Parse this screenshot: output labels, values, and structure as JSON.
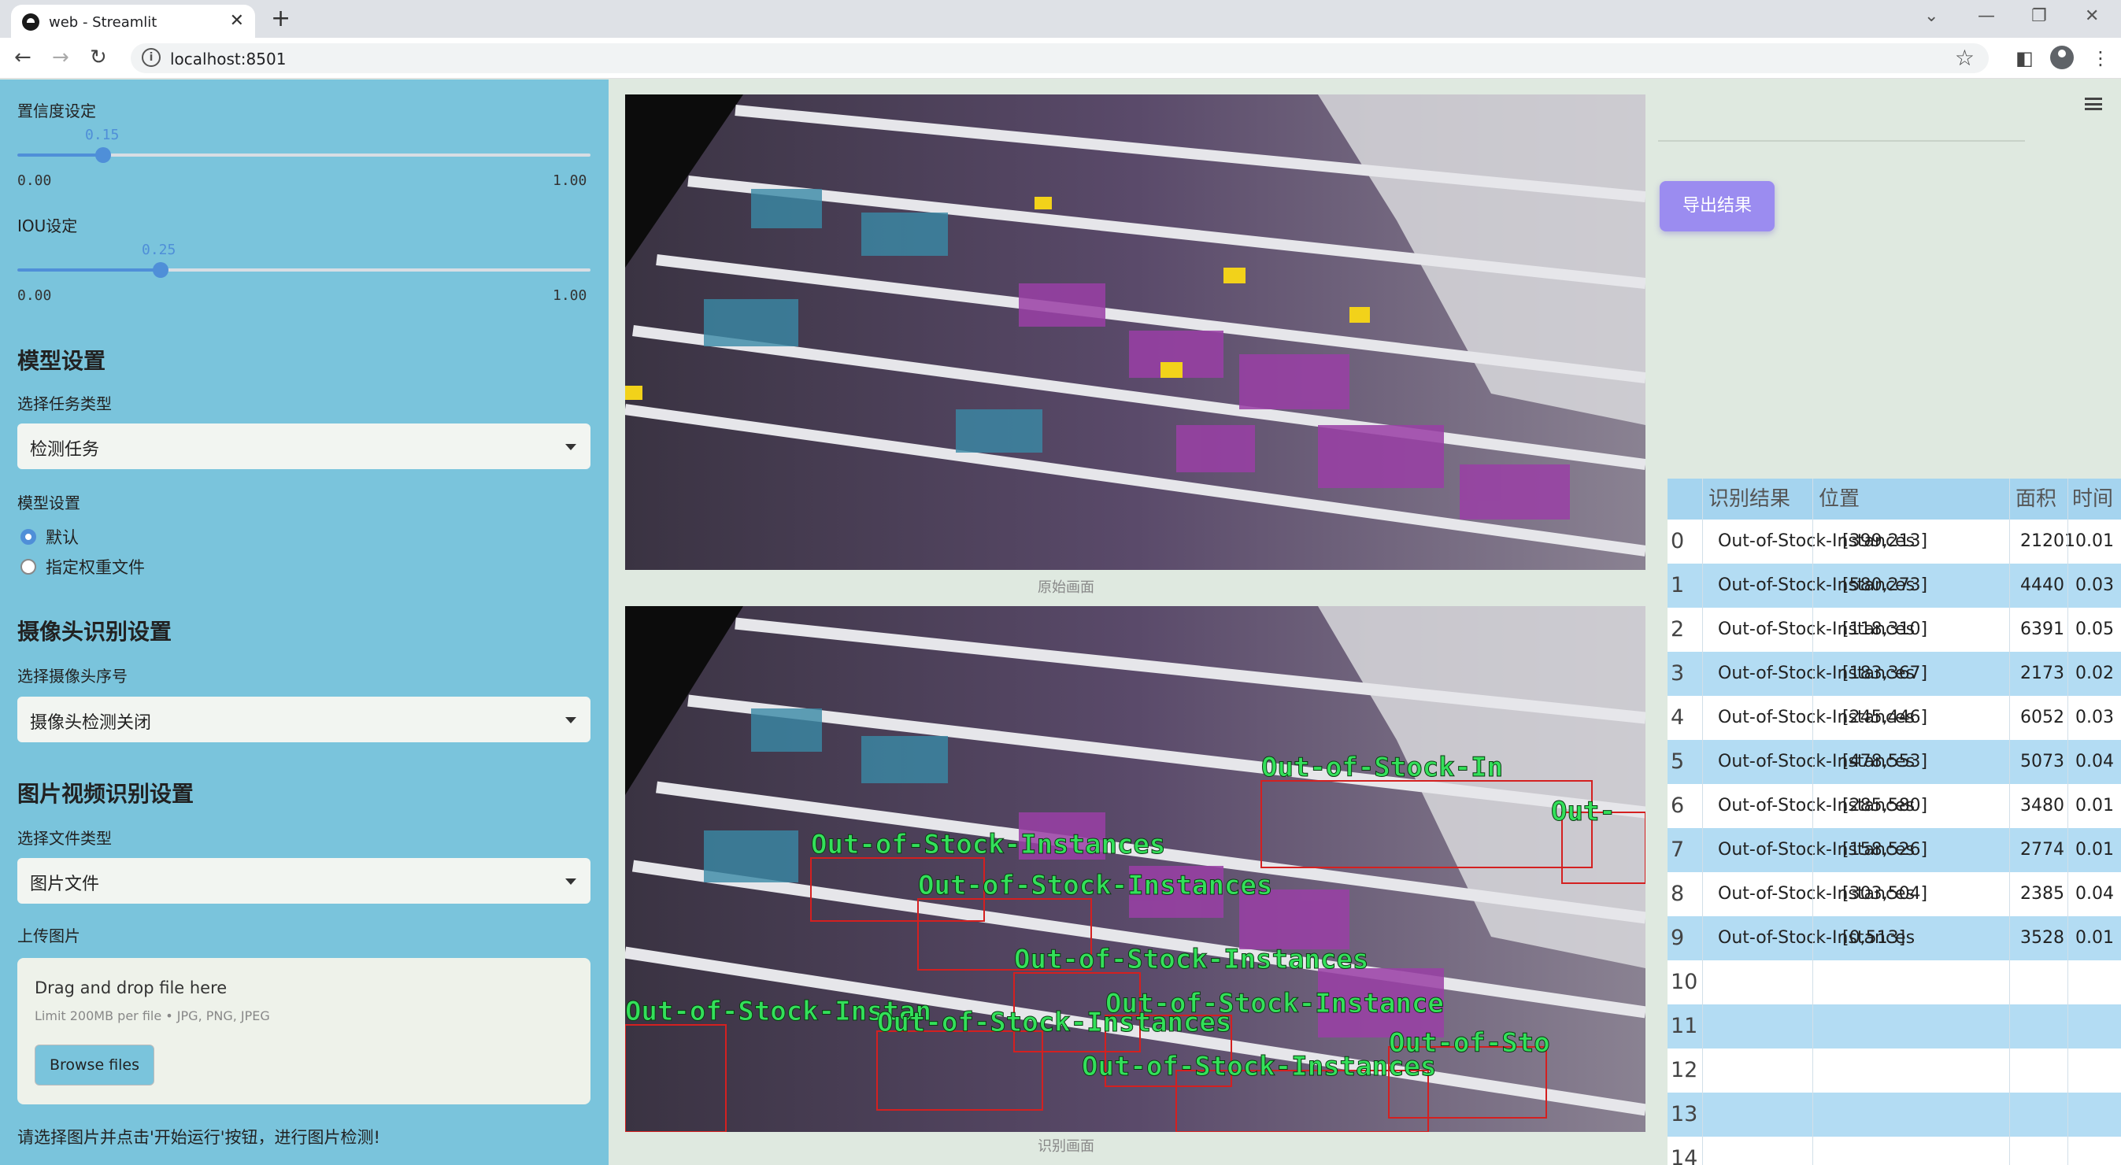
{
  "browser": {
    "tab_title": "web - Streamlit",
    "url": "localhost:8501"
  },
  "sidebar": {
    "confidence": {
      "label": "置信度设定",
      "value": "0.15",
      "value_num": 0.15,
      "min": "0.00",
      "max": "1.00"
    },
    "iou": {
      "label": "IOU设定",
      "value": "0.25",
      "value_num": 0.25,
      "min": "0.00",
      "max": "1.00"
    },
    "model_header": "模型设置",
    "task_label": "选择任务类型",
    "task_value": "检测任务",
    "model_label": "模型设置",
    "model_options": [
      "默认",
      "指定权重文件"
    ],
    "model_selected": "默认",
    "camera_header": "摄像头识别设置",
    "camera_label": "选择摄像头序号",
    "camera_value": "摄像头检测关闭",
    "media_header": "图片视频识别设置",
    "filetype_label": "选择文件类型",
    "filetype_value": "图片文件",
    "upload_label": "上传图片",
    "upload_title": "Drag and drop file here",
    "upload_limit": "Limit 200MB per file • JPG, PNG, JPEG",
    "browse_label": "Browse files",
    "hint": "请选择图片并点击'开始运行'按钮，进行图片检测!"
  },
  "main": {
    "original_caption": "原始画面",
    "result_caption": "识别画面",
    "export_label": "导出结果",
    "detection_labels": [
      "Out-of-Stock-In",
      "Out-",
      "Out-of-Stock-Instances",
      "Out-of-Stock-Instances",
      "Out-of-Stock-Instances",
      "Out-of-Stock-Instan",
      "Out-of-Stock-Instance",
      "Out-of-Stock-Instances",
      "Out-of-Sto",
      "Out-of-Stock-Instances"
    ]
  },
  "table": {
    "headers": [
      "识别结果",
      "位置",
      "面积",
      "时间"
    ],
    "rows": [
      {
        "idx": "0",
        "result": "Out-of-Stock-Instances",
        "pos": "[399,213]",
        "area": "21201",
        "time": "0.01"
      },
      {
        "idx": "1",
        "result": "Out-of-Stock-Instances",
        "pos": "[580,273]",
        "area": "4440",
        "time": "0.03"
      },
      {
        "idx": "2",
        "result": "Out-of-Stock-Instances",
        "pos": "[118,310]",
        "area": "6391",
        "time": "0.05"
      },
      {
        "idx": "3",
        "result": "Out-of-Stock-Instances",
        "pos": "[183,367]",
        "area": "2173",
        "time": "0.02"
      },
      {
        "idx": "4",
        "result": "Out-of-Stock-Instances",
        "pos": "[245,446]",
        "area": "6052",
        "time": "0.03"
      },
      {
        "idx": "5",
        "result": "Out-of-Stock-Instances",
        "pos": "[478,553]",
        "area": "5073",
        "time": "0.04"
      },
      {
        "idx": "6",
        "result": "Out-of-Stock-Instances",
        "pos": "[285,580]",
        "area": "3480",
        "time": "0.01"
      },
      {
        "idx": "7",
        "result": "Out-of-Stock-Instances",
        "pos": "[158,526]",
        "area": "2774",
        "time": "0.01"
      },
      {
        "idx": "8",
        "result": "Out-of-Stock-Instances",
        "pos": "[303,504]",
        "area": "2385",
        "time": "0.04"
      },
      {
        "idx": "9",
        "result": "Out-of-Stock-Instances",
        "pos": "[0,513]",
        "area": "3528",
        "time": "0.01"
      },
      {
        "idx": "10",
        "result": "",
        "pos": "",
        "area": "",
        "time": ""
      },
      {
        "idx": "11",
        "result": "",
        "pos": "",
        "area": "",
        "time": ""
      },
      {
        "idx": "12",
        "result": "",
        "pos": "",
        "area": "",
        "time": ""
      },
      {
        "idx": "13",
        "result": "",
        "pos": "",
        "area": "",
        "time": ""
      },
      {
        "idx": "14",
        "result": "",
        "pos": "",
        "area": "",
        "time": ""
      }
    ]
  }
}
